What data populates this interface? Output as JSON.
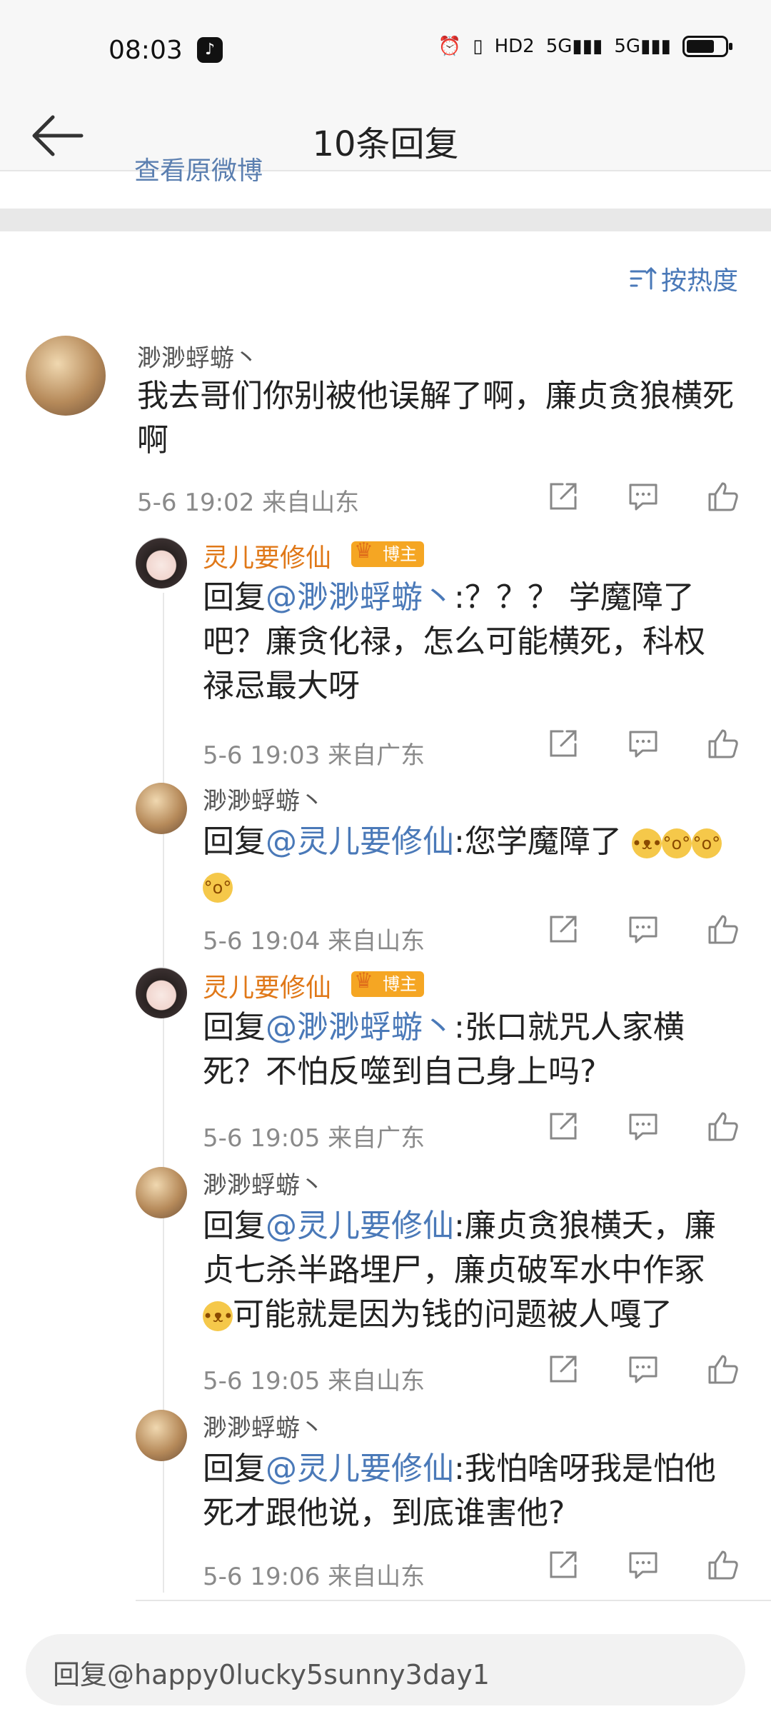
{
  "status": {
    "time": "08:03",
    "icons": [
      "alarm-icon",
      "vibrate-icon",
      "hd-icon",
      "5g-signal-icon",
      "5g-signal-icon",
      "battery-icon"
    ],
    "hd": "HD2",
    "g1": "5G",
    "g2": "5G"
  },
  "nav": {
    "title": "10条回复"
  },
  "peek_text": "查看原微博",
  "sort": {
    "label": "按热度"
  },
  "main_comment": {
    "user": "渺渺蜉蝣丶",
    "text": "我去哥们你别被他误解了啊，廉贞贪狼横死啊",
    "meta": "5-6 19:02  来自山东"
  },
  "replies": [
    {
      "user": "灵儿要修仙",
      "badge": "博主",
      "reply_prefix": "回复",
      "reply_to": "@渺渺蜉蝣丶",
      "text": ":？？？ 学魔障了吧？廉贪化禄，怎么可能横死，科权禄忌最大呀",
      "meta": "5-6 19:03  来自广东"
    },
    {
      "user": "渺渺蜉蝣丶",
      "reply_prefix": "回复",
      "reply_to": "@灵儿要修仙",
      "text": ":您学魔障了",
      "emojis": [
        "doge",
        "吃瓜",
        "吃瓜",
        "吃瓜"
      ],
      "meta": "5-6 19:04  来自山东"
    },
    {
      "user": "灵儿要修仙",
      "badge": "博主",
      "reply_prefix": "回复",
      "reply_to": "@渺渺蜉蝣丶",
      "text": ":张口就咒人家横死？不怕反噬到自己身上吗?",
      "meta": "5-6 19:05  来自广东"
    },
    {
      "user": "渺渺蜉蝣丶",
      "reply_prefix": "回复",
      "reply_to": "@灵儿要修仙",
      "text": ":廉贞贪狼横夭，廉贞七杀半路埋尸，廉贞破军水中作冢",
      "text2": "可能就是因为钱的问题被人嘎了",
      "emoji": "doge",
      "meta": "5-6 19:05  来自山东"
    },
    {
      "user": "渺渺蜉蝣丶",
      "reply_prefix": "回复",
      "reply_to": "@灵儿要修仙",
      "text": ":我怕啥呀我是怕他死才跟他说，到底谁害他?",
      "meta": "5-6 19:06  来自山东"
    }
  ],
  "reply_box": {
    "placeholder": "回复@happy0lucky5sunny3day1"
  },
  "colors": {
    "link": "#4a79b8",
    "orange_name": "#e07818",
    "badge": "#f5a623",
    "meta": "#8a8a8a"
  }
}
